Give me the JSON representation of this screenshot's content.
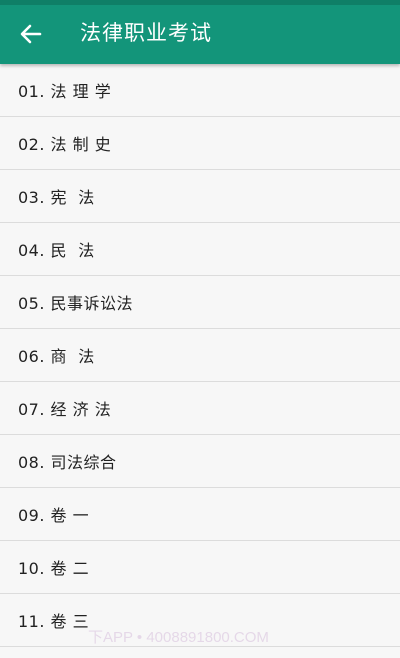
{
  "app_bar": {
    "title": "法律职业考试",
    "back_icon": "arrow-left-icon",
    "color": "#13957a"
  },
  "list": {
    "items": [
      {
        "label": "01. 法 理 学"
      },
      {
        "label": "02. 法 制 史"
      },
      {
        "label": "03. 宪  法"
      },
      {
        "label": "04. 民  法"
      },
      {
        "label": "05. 民事诉讼法"
      },
      {
        "label": "06. 商  法"
      },
      {
        "label": "07. 经 济 法"
      },
      {
        "label": "08. 司法综合"
      },
      {
        "label": "09. 卷 一"
      },
      {
        "label": "10. 卷 二"
      },
      {
        "label": "11. 卷 三"
      }
    ]
  },
  "watermark": {
    "text": "下APP • 4008891800.COM"
  }
}
